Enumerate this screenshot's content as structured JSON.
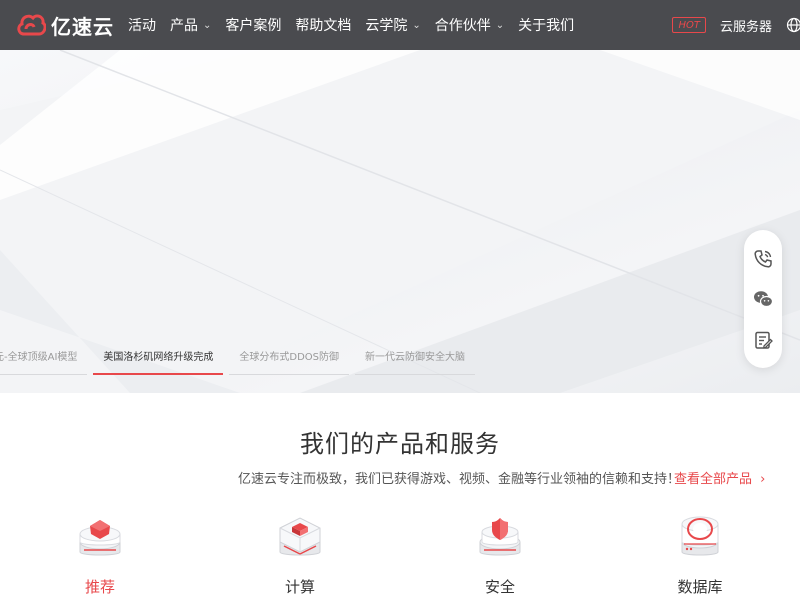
{
  "logo": {
    "text": "亿速云"
  },
  "nav": {
    "items": [
      {
        "label": "活动",
        "dropdown": false
      },
      {
        "label": "产品",
        "dropdown": true
      },
      {
        "label": "客户案例",
        "dropdown": false
      },
      {
        "label": "帮助文档",
        "dropdown": false
      },
      {
        "label": "云学院",
        "dropdown": true
      },
      {
        "label": "合作伙伴",
        "dropdown": true
      },
      {
        "label": "关于我们",
        "dropdown": false
      }
    ],
    "hot_badge": "HOT",
    "cloud_server": "云服务器",
    "globe_icon": "globe-icon"
  },
  "hero": {
    "tabs": [
      {
        "label": "元-全球顶级AI模型",
        "active": false
      },
      {
        "label": "美国洛杉矶网络升级完成",
        "active": true
      },
      {
        "label": "全球分布式DDOS防御",
        "active": false
      },
      {
        "label": "新一代云防御安全大脑",
        "active": false
      }
    ]
  },
  "float_bar": {
    "icons": [
      "phone-icon",
      "wechat-icon",
      "feedback-icon"
    ]
  },
  "products": {
    "title": "我们的产品和服务",
    "subtitle": "亿速云专注而极致，我们已获得游戏、视频、金融等行业领袖的信赖和支持！",
    "view_all": "查看全部产品",
    "categories": [
      {
        "label": "推荐",
        "active": true
      },
      {
        "label": "计算",
        "active": false
      },
      {
        "label": "安全",
        "active": false
      },
      {
        "label": "数据库",
        "active": false
      }
    ]
  },
  "colors": {
    "accent": "#e8484b",
    "nav_bg": "#4a4b4f"
  }
}
